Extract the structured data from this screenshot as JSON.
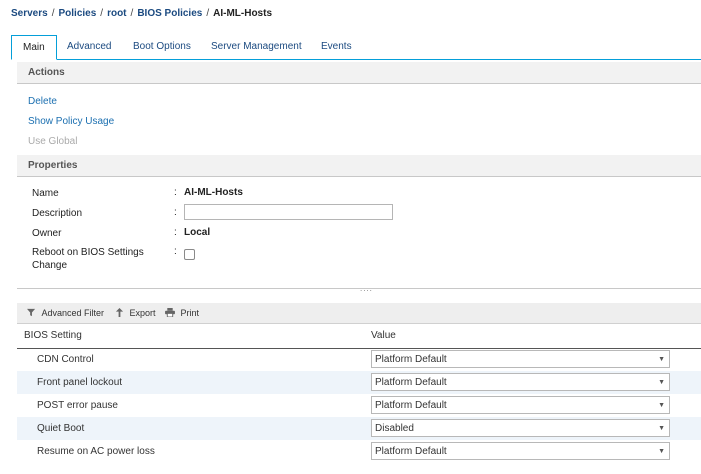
{
  "breadcrumb": [
    "Servers",
    "Policies",
    "root",
    "BIOS Policies",
    "AI-ML-Hosts"
  ],
  "breadcrumb_separator": "/",
  "tabs": [
    "Main",
    "Advanced",
    "Boot Options",
    "Server Management",
    "Events"
  ],
  "active_tab": "Main",
  "actions": {
    "title": "Actions",
    "delete": "Delete",
    "show_policy_usage": "Show Policy Usage",
    "use_global": "Use Global"
  },
  "properties": {
    "title": "Properties",
    "name_label": "Name",
    "name_value": "AI-ML-Hosts",
    "description_label": "Description",
    "description_value": "",
    "owner_label": "Owner",
    "owner_value": "Local",
    "reboot_label_line1": "Reboot on BIOS Settings",
    "reboot_label_line2": "Change",
    "reboot_checked": false,
    "colon": ":"
  },
  "splitter_grip": "....",
  "toolbar": {
    "advanced_filter": "Advanced Filter",
    "export": "Export",
    "print": "Print"
  },
  "grid": {
    "col_setting": "BIOS Setting",
    "col_value": "Value",
    "rows": [
      {
        "setting": "CDN Control",
        "value": "Platform Default"
      },
      {
        "setting": "Front panel lockout",
        "value": "Platform Default"
      },
      {
        "setting": "POST error pause",
        "value": "Platform Default"
      },
      {
        "setting": "Quiet Boot",
        "value": "Disabled"
      },
      {
        "setting": "Resume on AC power loss",
        "value": "Platform Default"
      }
    ]
  },
  "colors": {
    "link": "#1b6fb0",
    "breadcrumb": "#1b4a80",
    "tab_active_border": "#049fd9",
    "row_alt": "#eef4fa"
  }
}
